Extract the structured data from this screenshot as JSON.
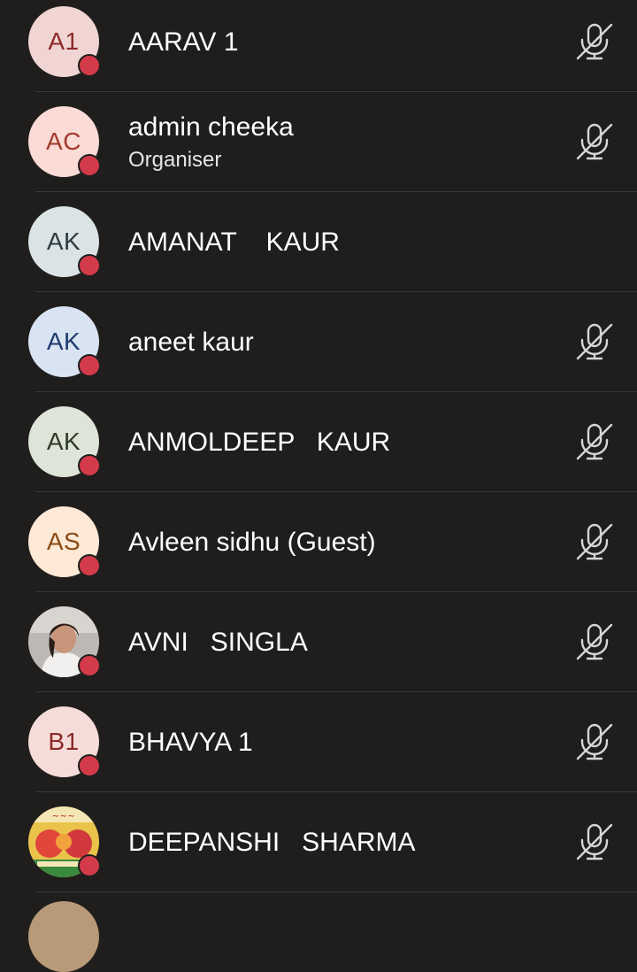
{
  "participants": [
    {
      "initials": "A1",
      "name": "AARAV 1",
      "role": "",
      "avatar_bg": "#f0d5d3",
      "avatar_fg": "#8c2a2a",
      "photo": "",
      "muted": true
    },
    {
      "initials": "AC",
      "name": "admin cheeka",
      "role": "Organiser",
      "avatar_bg": "#fadbd6",
      "avatar_fg": "#a33a2c",
      "photo": "",
      "muted": true
    },
    {
      "initials": "AK",
      "name": "AMANAT    KAUR",
      "role": "",
      "avatar_bg": "#dbe3e5",
      "avatar_fg": "#2a3a40",
      "photo": "",
      "muted": false
    },
    {
      "initials": "AK",
      "name": "aneet kaur",
      "role": "",
      "avatar_bg": "#d9e4f3",
      "avatar_fg": "#1f3a6e",
      "photo": "",
      "muted": true
    },
    {
      "initials": "AK",
      "name": "ANMOLDEEP   KAUR",
      "role": "",
      "avatar_bg": "#dfe4d8",
      "avatar_fg": "#2e3b28",
      "photo": "",
      "muted": true
    },
    {
      "initials": "AS",
      "name": "Avleen sidhu (Guest)",
      "role": "",
      "avatar_bg": "#fde9d6",
      "avatar_fg": "#8a4a14",
      "photo": "",
      "muted": true
    },
    {
      "initials": "",
      "name": "AVNI   SINGLA",
      "role": "",
      "avatar_bg": "#c9c4bf",
      "avatar_fg": "#333333",
      "photo": "person-photo",
      "muted": true
    },
    {
      "initials": "B1",
      "name": "BHAVYA 1",
      "role": "",
      "avatar_bg": "#f6dcd8",
      "avatar_fg": "#8c2a2a",
      "photo": "",
      "muted": true
    },
    {
      "initials": "",
      "name": "DEEPANSHI   SHARMA",
      "role": "",
      "avatar_bg": "#d84a3a",
      "avatar_fg": "#ffffff",
      "photo": "festival-photo",
      "muted": true
    }
  ],
  "presence_color": "#d33b4b",
  "mic_icon": "mic-off-icon"
}
